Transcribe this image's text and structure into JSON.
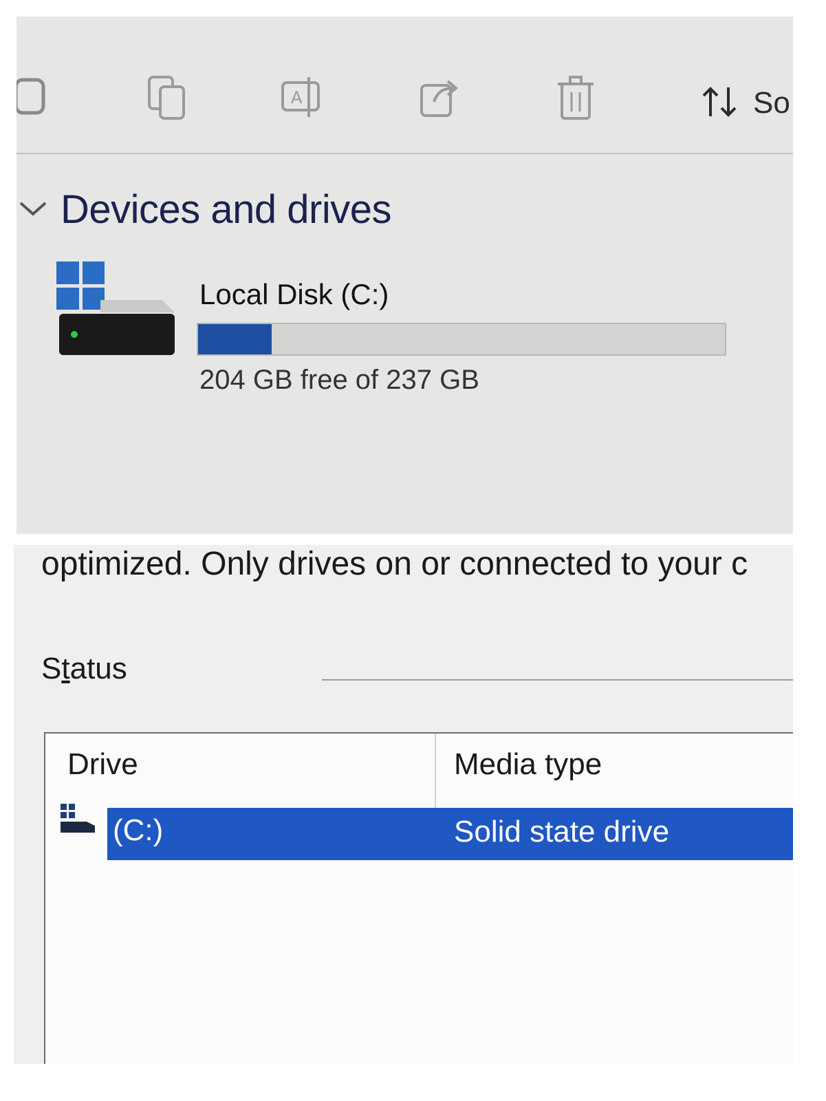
{
  "explorer": {
    "toolbar": {
      "icons": [
        "new-icon",
        "copy-icon",
        "rename-icon",
        "share-icon",
        "delete-icon"
      ],
      "sort_label": "So"
    },
    "section_title": "Devices and drives",
    "drive": {
      "name": "Local Disk (C:)",
      "free_text": "204 GB free of 237 GB",
      "used_fraction": 0.14
    }
  },
  "optimize": {
    "description": "optimized. Only drives on or connected to your c",
    "status_label_pre": "S",
    "status_label_accel": "t",
    "status_label_post": "atus",
    "columns": {
      "drive": "Drive",
      "media_type": "Media type"
    },
    "rows": [
      {
        "drive": "(C:)",
        "media_type": "Solid state drive",
        "selected": true
      }
    ]
  },
  "colors": {
    "accent": "#1f57c3",
    "usage_fill": "#1e4fa3",
    "windows_logo": "#2a6dc2"
  }
}
